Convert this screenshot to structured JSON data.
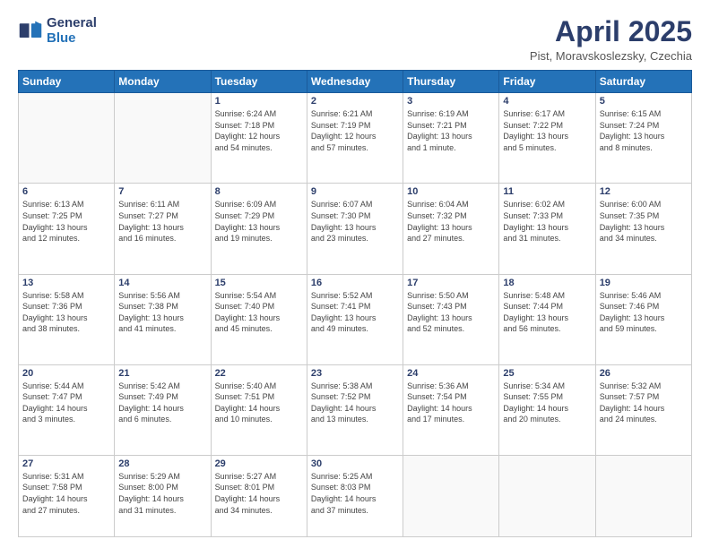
{
  "header": {
    "logo_line1": "General",
    "logo_line2": "Blue",
    "month": "April 2025",
    "location": "Pist, Moravskoslezsky, Czechia"
  },
  "weekdays": [
    "Sunday",
    "Monday",
    "Tuesday",
    "Wednesday",
    "Thursday",
    "Friday",
    "Saturday"
  ],
  "weeks": [
    [
      {
        "day": "",
        "info": ""
      },
      {
        "day": "",
        "info": ""
      },
      {
        "day": "1",
        "info": "Sunrise: 6:24 AM\nSunset: 7:18 PM\nDaylight: 12 hours\nand 54 minutes."
      },
      {
        "day": "2",
        "info": "Sunrise: 6:21 AM\nSunset: 7:19 PM\nDaylight: 12 hours\nand 57 minutes."
      },
      {
        "day": "3",
        "info": "Sunrise: 6:19 AM\nSunset: 7:21 PM\nDaylight: 13 hours\nand 1 minute."
      },
      {
        "day": "4",
        "info": "Sunrise: 6:17 AM\nSunset: 7:22 PM\nDaylight: 13 hours\nand 5 minutes."
      },
      {
        "day": "5",
        "info": "Sunrise: 6:15 AM\nSunset: 7:24 PM\nDaylight: 13 hours\nand 8 minutes."
      }
    ],
    [
      {
        "day": "6",
        "info": "Sunrise: 6:13 AM\nSunset: 7:25 PM\nDaylight: 13 hours\nand 12 minutes."
      },
      {
        "day": "7",
        "info": "Sunrise: 6:11 AM\nSunset: 7:27 PM\nDaylight: 13 hours\nand 16 minutes."
      },
      {
        "day": "8",
        "info": "Sunrise: 6:09 AM\nSunset: 7:29 PM\nDaylight: 13 hours\nand 19 minutes."
      },
      {
        "day": "9",
        "info": "Sunrise: 6:07 AM\nSunset: 7:30 PM\nDaylight: 13 hours\nand 23 minutes."
      },
      {
        "day": "10",
        "info": "Sunrise: 6:04 AM\nSunset: 7:32 PM\nDaylight: 13 hours\nand 27 minutes."
      },
      {
        "day": "11",
        "info": "Sunrise: 6:02 AM\nSunset: 7:33 PM\nDaylight: 13 hours\nand 31 minutes."
      },
      {
        "day": "12",
        "info": "Sunrise: 6:00 AM\nSunset: 7:35 PM\nDaylight: 13 hours\nand 34 minutes."
      }
    ],
    [
      {
        "day": "13",
        "info": "Sunrise: 5:58 AM\nSunset: 7:36 PM\nDaylight: 13 hours\nand 38 minutes."
      },
      {
        "day": "14",
        "info": "Sunrise: 5:56 AM\nSunset: 7:38 PM\nDaylight: 13 hours\nand 41 minutes."
      },
      {
        "day": "15",
        "info": "Sunrise: 5:54 AM\nSunset: 7:40 PM\nDaylight: 13 hours\nand 45 minutes."
      },
      {
        "day": "16",
        "info": "Sunrise: 5:52 AM\nSunset: 7:41 PM\nDaylight: 13 hours\nand 49 minutes."
      },
      {
        "day": "17",
        "info": "Sunrise: 5:50 AM\nSunset: 7:43 PM\nDaylight: 13 hours\nand 52 minutes."
      },
      {
        "day": "18",
        "info": "Sunrise: 5:48 AM\nSunset: 7:44 PM\nDaylight: 13 hours\nand 56 minutes."
      },
      {
        "day": "19",
        "info": "Sunrise: 5:46 AM\nSunset: 7:46 PM\nDaylight: 13 hours\nand 59 minutes."
      }
    ],
    [
      {
        "day": "20",
        "info": "Sunrise: 5:44 AM\nSunset: 7:47 PM\nDaylight: 14 hours\nand 3 minutes."
      },
      {
        "day": "21",
        "info": "Sunrise: 5:42 AM\nSunset: 7:49 PM\nDaylight: 14 hours\nand 6 minutes."
      },
      {
        "day": "22",
        "info": "Sunrise: 5:40 AM\nSunset: 7:51 PM\nDaylight: 14 hours\nand 10 minutes."
      },
      {
        "day": "23",
        "info": "Sunrise: 5:38 AM\nSunset: 7:52 PM\nDaylight: 14 hours\nand 13 minutes."
      },
      {
        "day": "24",
        "info": "Sunrise: 5:36 AM\nSunset: 7:54 PM\nDaylight: 14 hours\nand 17 minutes."
      },
      {
        "day": "25",
        "info": "Sunrise: 5:34 AM\nSunset: 7:55 PM\nDaylight: 14 hours\nand 20 minutes."
      },
      {
        "day": "26",
        "info": "Sunrise: 5:32 AM\nSunset: 7:57 PM\nDaylight: 14 hours\nand 24 minutes."
      }
    ],
    [
      {
        "day": "27",
        "info": "Sunrise: 5:31 AM\nSunset: 7:58 PM\nDaylight: 14 hours\nand 27 minutes."
      },
      {
        "day": "28",
        "info": "Sunrise: 5:29 AM\nSunset: 8:00 PM\nDaylight: 14 hours\nand 31 minutes."
      },
      {
        "day": "29",
        "info": "Sunrise: 5:27 AM\nSunset: 8:01 PM\nDaylight: 14 hours\nand 34 minutes."
      },
      {
        "day": "30",
        "info": "Sunrise: 5:25 AM\nSunset: 8:03 PM\nDaylight: 14 hours\nand 37 minutes."
      },
      {
        "day": "",
        "info": ""
      },
      {
        "day": "",
        "info": ""
      },
      {
        "day": "",
        "info": ""
      }
    ]
  ]
}
